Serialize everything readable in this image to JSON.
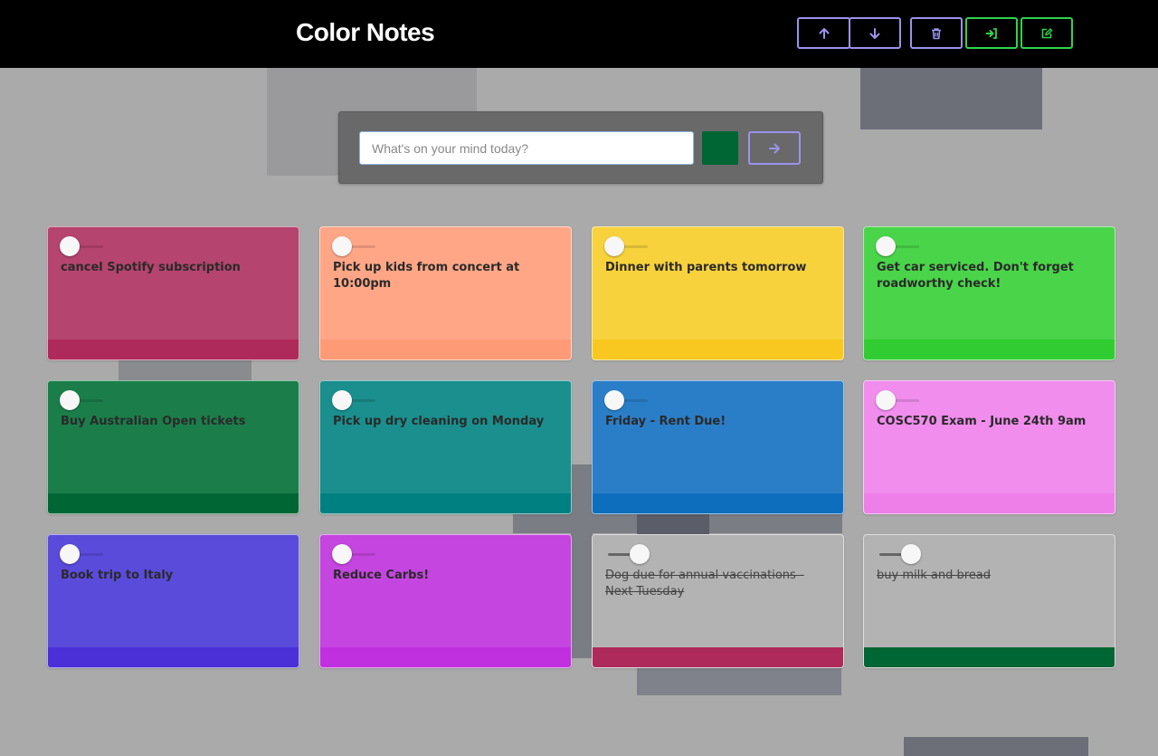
{
  "app": {
    "title": "Color Notes"
  },
  "toolbar": {
    "buttons": [
      {
        "name": "move-up-button",
        "icon": "arrow-up-icon",
        "color": "#9b93ec"
      },
      {
        "name": "move-down-button",
        "icon": "arrow-down-icon",
        "color": "#9b93ec"
      },
      {
        "name": "delete-button",
        "icon": "trash-icon",
        "color": "#9b93ec"
      },
      {
        "name": "sign-in-button",
        "icon": "sign-in-icon",
        "color": "#2fd44a"
      },
      {
        "name": "edit-button",
        "icon": "edit-icon",
        "color": "#2fd44a"
      }
    ]
  },
  "composer": {
    "placeholder": "What's on your mind today?",
    "value": "",
    "selected_color": "#006633",
    "submit_icon": "arrow-right-icon"
  },
  "notes": [
    {
      "text": "cancel Spotify subscription",
      "color": "#b5446e",
      "footer": "#ae2a5a",
      "done": false
    },
    {
      "text": "Pick up kids from concert at 10:00pm",
      "color": "#ffa686",
      "footer": "#ff9a77",
      "done": false
    },
    {
      "text": "Dinner with parents tomorrow",
      "color": "#f8d23c",
      "footer": "#f8c820",
      "done": false
    },
    {
      "text": "Get car serviced. Don't forget roadworthy check!",
      "color": "#4ad44a",
      "footer": "#31cc31",
      "done": false
    },
    {
      "text": "Buy Australian Open tickets",
      "color": "#1b7e4a",
      "footer": "#006633",
      "done": false
    },
    {
      "text": "Pick up dry cleaning on Monday",
      "color": "#1a8f8d",
      "footer": "#008080",
      "done": false
    },
    {
      "text": "Friday - Rent Due!",
      "color": "#2a7ec8",
      "footer": "#0d6ebd",
      "done": false
    },
    {
      "text": "COSC570 Exam - June 24th 9am",
      "color": "#f08ded",
      "footer": "#ee7fe9",
      "done": false
    },
    {
      "text": "Book trip to Italy",
      "color": "#5a4bdb",
      "footer": "#4a30d6",
      "done": false
    },
    {
      "text": "Reduce Carbs!",
      "color": "#c545e0",
      "footer": "#c030de",
      "done": false
    },
    {
      "text": "Dog due for annual vaccinations - Next Tuesday",
      "color": "#b3b3b3",
      "footer": "#ae2a5a",
      "done": true
    },
    {
      "text": "buy milk and bread",
      "color": "#b3b3b3",
      "footer": "#006633",
      "done": true
    }
  ]
}
